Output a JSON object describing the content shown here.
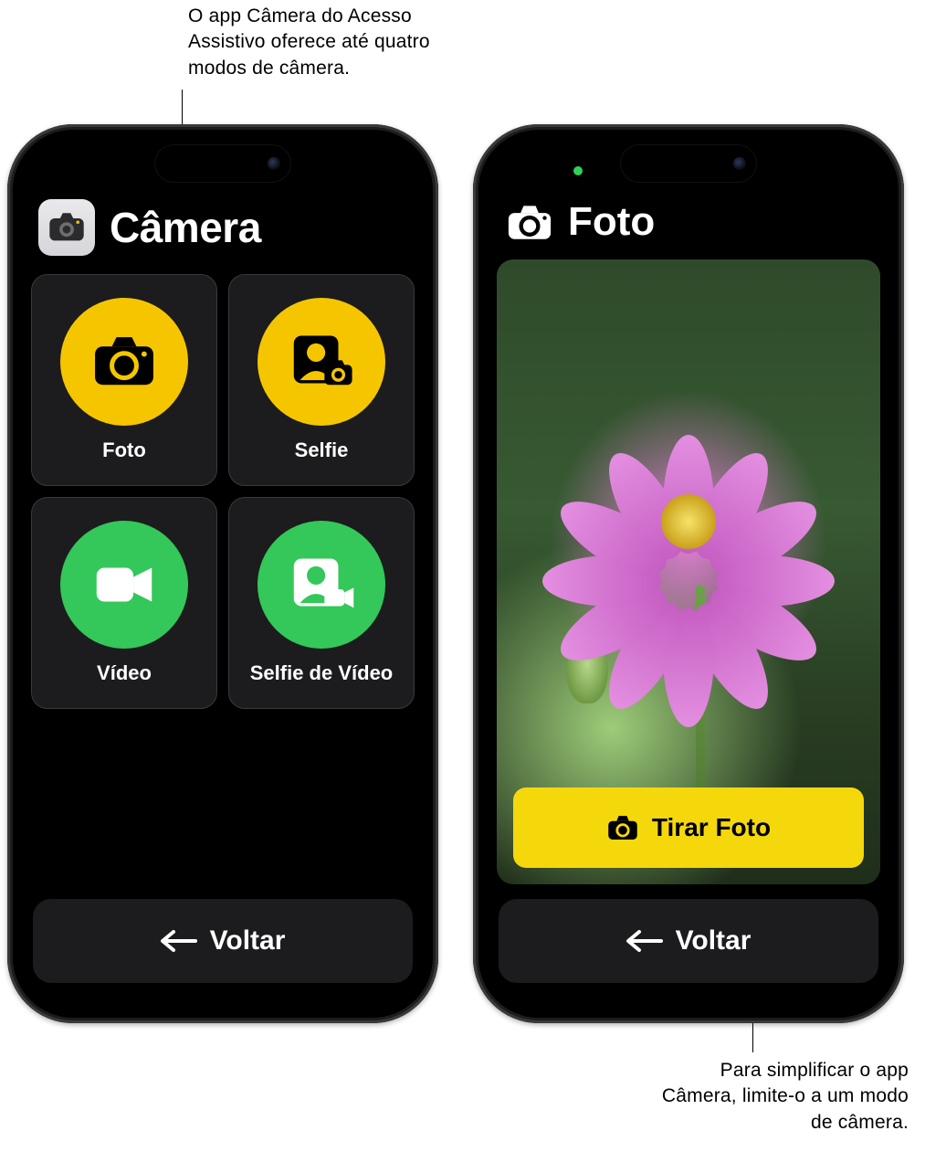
{
  "callouts": {
    "top": "O app Câmera do Acesso Assistivo oferece até quatro modos de câmera.",
    "bottom": "Para simplificar o app Câmera, limite-o a um modo de câmera."
  },
  "left_phone": {
    "header": {
      "title": "Câmera",
      "icon": "camera-icon"
    },
    "tiles": [
      {
        "label": "Foto",
        "icon": "camera-icon",
        "color": "yellow"
      },
      {
        "label": "Selfie",
        "icon": "person-camera-icon",
        "color": "yellow"
      },
      {
        "label": "Vídeo",
        "icon": "video-icon",
        "color": "green"
      },
      {
        "label": "Selfie de Vídeo",
        "icon": "person-video-icon",
        "color": "green"
      }
    ],
    "back_label": "Voltar"
  },
  "right_phone": {
    "header": {
      "title": "Foto",
      "icon": "camera-icon"
    },
    "take_photo_label": "Tirar Foto",
    "back_label": "Voltar",
    "status_indicator": "camera-in-use"
  },
  "colors": {
    "yellow": "#f5c600",
    "green": "#34c759",
    "tile_bg": "#1c1c1e",
    "take_photo_bg": "#f5d80c"
  }
}
